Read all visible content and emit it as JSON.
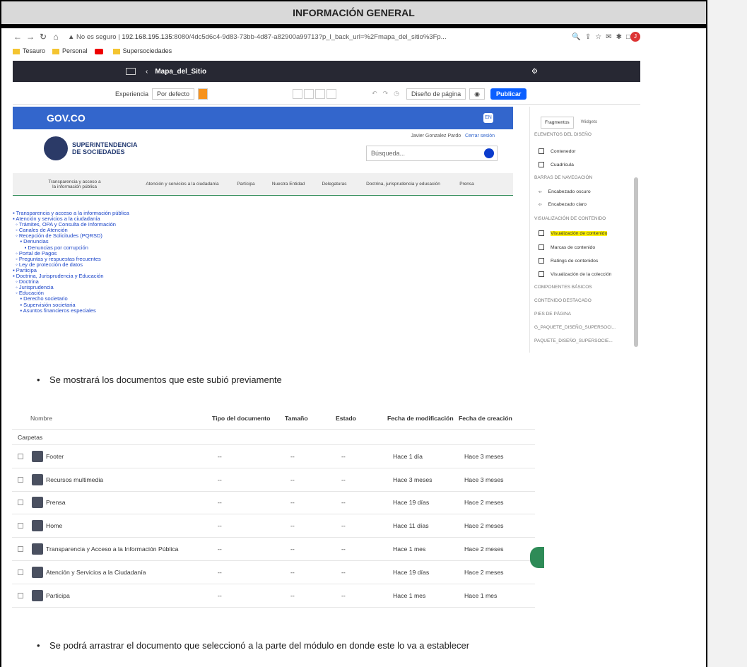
{
  "doc": {
    "heading": "INFORMACIÓN GENERAL",
    "bullet1": "Se mostrará los documentos que este subió previamente",
    "bullet2": "Se podrá arrastrar el documento que seleccionó a la parte del módulo en donde este lo va a establecer"
  },
  "browser": {
    "insecure": "No es seguro",
    "url_host": "192.168.195.135",
    "url_rest": ":8080/4dc5d6c4-9d83-73bb-4d87-a82900a99713?p_l_back_url=%2Fmapa_del_sitio%3Fp...",
    "avatar": "J",
    "bookmarks": [
      "Tesauro",
      "Personal",
      "Supersociedades"
    ]
  },
  "liferay": {
    "page_title": "Mapa_del_Sitio",
    "experience_label": "Experiencia",
    "experience_value": "Por defecto",
    "layout_select": "Diseño de página",
    "publish": "Publicar"
  },
  "site": {
    "gov": "GOV.CO",
    "lang": "EN",
    "brand_line1": "SUPERINTENDENCIA",
    "brand_line2": "DE SOCIEDADES",
    "user": "Javier Gonzalez Pardo",
    "logout": "Cerrar sesión",
    "search_placeholder": "Búsqueda...",
    "menu": [
      "Transparencia y acceso a la información pública",
      "Atención y servicios a la ciudadanía",
      "Participa",
      "Nuestra Entidad",
      "Delegaturas",
      "Doctrina, jurisprudencia y educación",
      "Prensa"
    ],
    "sitemap": [
      "▪ Transparencia y acceso a la información pública",
      "▪ Atención y servicios a la ciudadanía",
      "  ◦ Trámites, OPA y Consulta de Información",
      "  ◦ Canales de Atención",
      "  ◦ Recepción de Solicitudes (PQRSD)",
      "     ▪ Denuncias",
      "        ▪ Denuncias por corrupción",
      "  ◦ Portal de Pagos",
      "  ◦ Preguntas y respuestas frecuentes",
      "  ◦ Ley de protección de datos",
      "▪ Participa",
      "▪ Doctrina, Jurisprudencia y Educación",
      "  ◦ Doctrina",
      "  ◦ Jurisprudencia",
      "  ◦ Educación",
      "     ▪ Derecho societario",
      "     ▪ Supervisión societaria",
      "     ▪ Asuntos financieros especiales"
    ]
  },
  "panel": {
    "tab_fragments": "Fragmentos",
    "tab_widgets": "Widgets",
    "s1": "ELEMENTOS DEL DISEÑO",
    "i1": "Contenedor",
    "i2": "Cuadrícula",
    "s2": "BARRAS DE NAVEGACIÓN",
    "i3": "Encabezado oscuro",
    "i4": "Encabezado claro",
    "s3": "VISUALIZACIÓN DE CONTENIDO",
    "i5": "Visualización de contenido",
    "i6": "Marcas de contenido",
    "i7": "Ratings de contenidos",
    "i8": "Visualización de la colección",
    "s4": "COMPONENTES BÁSICOS",
    "s5": "CONTENIDO DESTACADO",
    "s6": "PIES DE PÁGINA",
    "s7": "G_PAQUETE_DISEÑO_SUPERSOCI...",
    "s8": "PAQUETE_DISEÑO_SUPERSOCIE..."
  },
  "table": {
    "headers": [
      "Nombre",
      "Tipo del documento",
      "Tamaño",
      "Estado",
      "Fecha de modificación",
      "Fecha de creación"
    ],
    "group": "Carpetas",
    "rows": [
      {
        "name": "Footer",
        "type": "--",
        "size": "--",
        "state": "--",
        "modified": "Hace 1 día",
        "created": "Hace 3 meses"
      },
      {
        "name": "Recursos multimedia",
        "type": "--",
        "size": "--",
        "state": "--",
        "modified": "Hace 3 meses",
        "created": "Hace 3 meses"
      },
      {
        "name": "Prensa",
        "type": "--",
        "size": "--",
        "state": "--",
        "modified": "Hace 19 días",
        "created": "Hace 2 meses"
      },
      {
        "name": "Home",
        "type": "--",
        "size": "--",
        "state": "--",
        "modified": "Hace 11 días",
        "created": "Hace 2 meses"
      },
      {
        "name": "Transparencia y Acceso a la Información Pública",
        "type": "--",
        "size": "--",
        "state": "--",
        "modified": "Hace 1 mes",
        "created": "Hace 2 meses"
      },
      {
        "name": "Atención y Servicios a la Ciudadanía",
        "type": "--",
        "size": "--",
        "state": "--",
        "modified": "Hace 19 días",
        "created": "Hace 2 meses"
      },
      {
        "name": "Participa",
        "type": "--",
        "size": "--",
        "state": "--",
        "modified": "Hace 1 mes",
        "created": "Hace 1 mes"
      }
    ]
  }
}
